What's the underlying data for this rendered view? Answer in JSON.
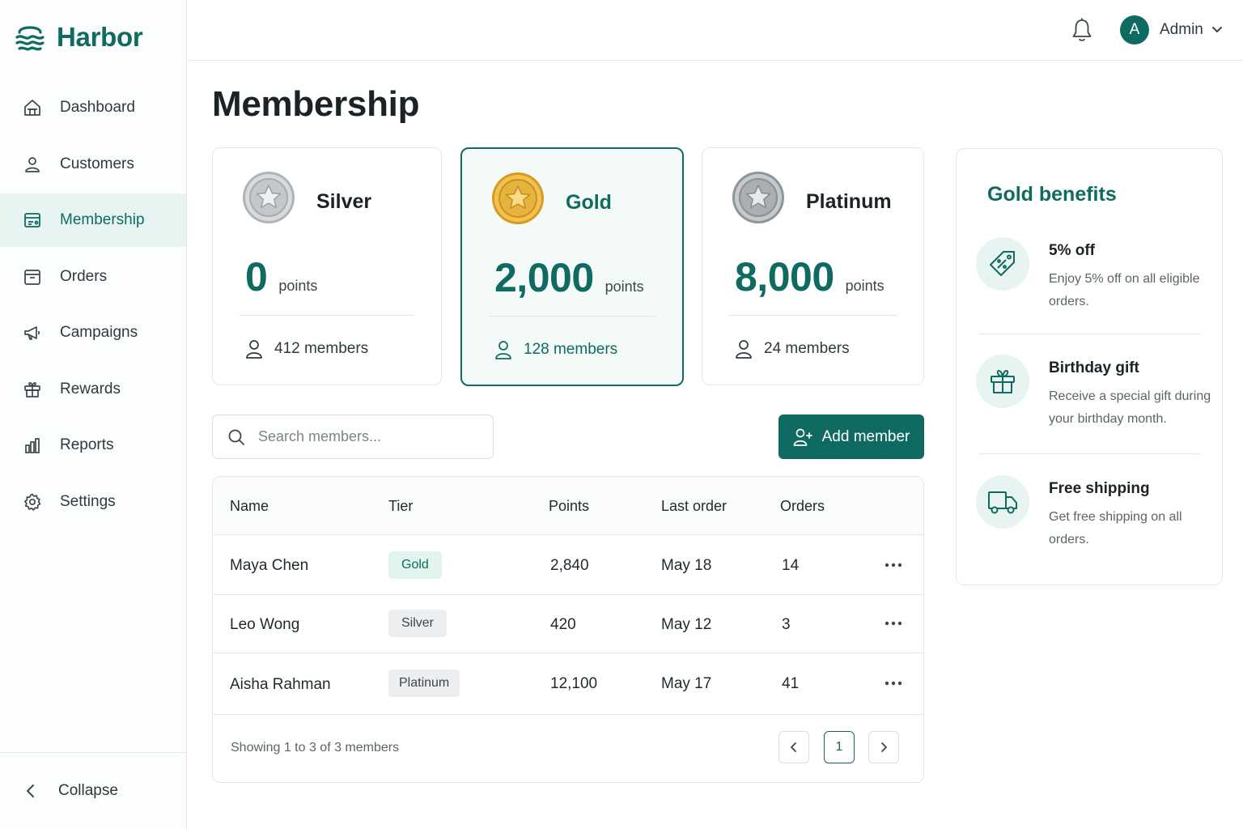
{
  "brand": {
    "name": "Harbor"
  },
  "sidebar": {
    "items": [
      {
        "label": "Dashboard",
        "icon": "home-icon"
      },
      {
        "label": "Customers",
        "icon": "user-icon"
      },
      {
        "label": "Membership",
        "icon": "membership-card-icon",
        "active": true
      },
      {
        "label": "Orders",
        "icon": "orders-box-icon"
      },
      {
        "label": "Campaigns",
        "icon": "megaphone-icon"
      },
      {
        "label": "Rewards",
        "icon": "gift-icon"
      },
      {
        "label": "Reports",
        "icon": "bar-chart-icon"
      },
      {
        "label": "Settings",
        "icon": "gear-icon"
      }
    ],
    "collapse_label": "Collapse"
  },
  "topbar": {
    "avatar_initial": "A",
    "user_label": "Admin"
  },
  "page": {
    "title": "Membership"
  },
  "tiers": [
    {
      "name": "Silver",
      "points": "0",
      "points_label": "points",
      "members": "412 members",
      "medal": "silver"
    },
    {
      "name": "Gold",
      "points": "2,000",
      "points_label": "points",
      "members": "128 members",
      "medal": "gold",
      "selected": true
    },
    {
      "name": "Platinum",
      "points": "8,000",
      "points_label": "points",
      "members": "24 members",
      "medal": "platinum"
    }
  ],
  "search": {
    "placeholder": "Search members..."
  },
  "actions": {
    "add_member_label": "Add member"
  },
  "table": {
    "columns": [
      "Name",
      "Tier",
      "Points",
      "Last order",
      "Orders"
    ],
    "rows": [
      {
        "name": "Maya Chen",
        "tier": "Gold",
        "points": "2,840",
        "last_order": "May 18",
        "orders": "14"
      },
      {
        "name": "Leo Wong",
        "tier": "Silver",
        "points": "420",
        "last_order": "May 12",
        "orders": "3"
      },
      {
        "name": "Aisha Rahman",
        "tier": "Platinum",
        "points": "12,100",
        "last_order": "May 17",
        "orders": "41"
      }
    ],
    "footer": "Showing 1 to 3 of 3 members",
    "current_page": "1"
  },
  "benefits": {
    "title": "Gold benefits",
    "items": [
      {
        "name": "5% off",
        "desc": "Enjoy 5% off on all eligible orders.",
        "icon": "discount-tag-icon"
      },
      {
        "name": "Birthday gift",
        "desc": "Receive a special gift during your birthday month.",
        "icon": "gift-icon"
      },
      {
        "name": "Free shipping",
        "desc": "Get free shipping on all orders.",
        "icon": "truck-icon"
      }
    ]
  },
  "colors": {
    "accent": "#0f6b61",
    "accent_light": "#e8f4f1",
    "gold_medal": "#e6b43c",
    "silver_medal": "#b9bec2"
  }
}
